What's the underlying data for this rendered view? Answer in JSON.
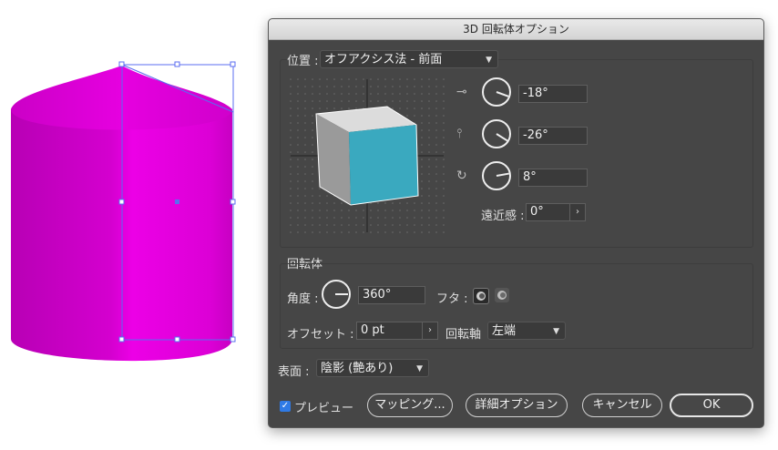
{
  "window": {
    "title": "3D 回転体オプション"
  },
  "position": {
    "label": "位置 :",
    "preset": "オフアクシス法 - 前面",
    "rotation_x": "-18°",
    "rotation_y": "-26°",
    "rotation_z": "8°",
    "perspective_label": "遠近感 :",
    "perspective_value": "0°"
  },
  "revolve": {
    "section_label": "回転体",
    "angle_label": "角度 :",
    "angle_value": "360°",
    "cap_label": "フタ :",
    "offset_label": "オフセット :",
    "offset_value": "0 pt",
    "axis_label": "回転軸",
    "axis_value": "左端"
  },
  "surface": {
    "label": "表面 :",
    "value": "陰影 (艶あり)"
  },
  "footer": {
    "preview_label": "プレビュー",
    "preview_checked": true,
    "mapping_button": "マッピング...",
    "more_options_button": "詳細オプション",
    "cancel_button": "キャンセル",
    "ok_button": "OK"
  },
  "colors": {
    "object_magenta": "#e000d8",
    "cube_front": "#3aa9bf",
    "selection_blue": "#5b6cf0",
    "checkbox_blue": "#2f7ae5"
  }
}
